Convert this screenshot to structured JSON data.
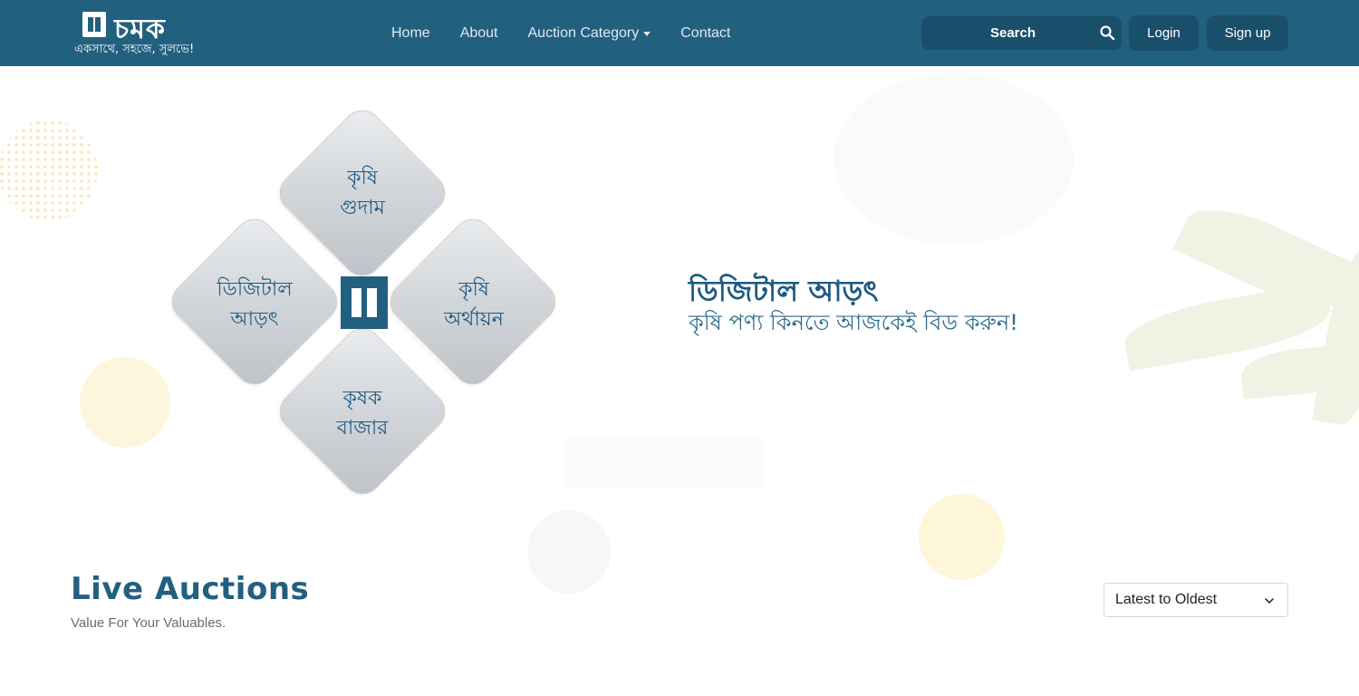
{
  "brand": {
    "name": "চমক",
    "tagline": "একসাথে, সহজে, সুলভে!"
  },
  "nav": {
    "items": [
      {
        "label": "Home"
      },
      {
        "label": "About"
      },
      {
        "label": "Auction Category",
        "has_dropdown": true
      },
      {
        "label": "Contact"
      }
    ]
  },
  "search": {
    "placeholder": "Search",
    "icon": "search-icon"
  },
  "auth": {
    "login_label": "Login",
    "signup_label": "Sign up"
  },
  "hero": {
    "tiles": {
      "top": {
        "line1": "কৃষি",
        "line2": "গুদাম"
      },
      "left": {
        "line1": "ডিজিটাল",
        "line2": "আড়ৎ"
      },
      "right": {
        "line1": "কৃষি",
        "line2": "অর্থায়ন"
      },
      "bottom": {
        "line1": "কৃষক",
        "line2": "বাজার"
      }
    },
    "title": "ডিজিটাল আড়ৎ",
    "subtitle": "কৃষি পণ্য কিনতে আজকেই বিড করুন!"
  },
  "auctions": {
    "title": "Live Auctions",
    "subtitle": "Value For Your Valuables.",
    "sort_selected": "Latest to Oldest"
  },
  "colors": {
    "primary": "#226080",
    "primary_dark": "#1a4f6b",
    "accent_text": "#1d5a80"
  }
}
